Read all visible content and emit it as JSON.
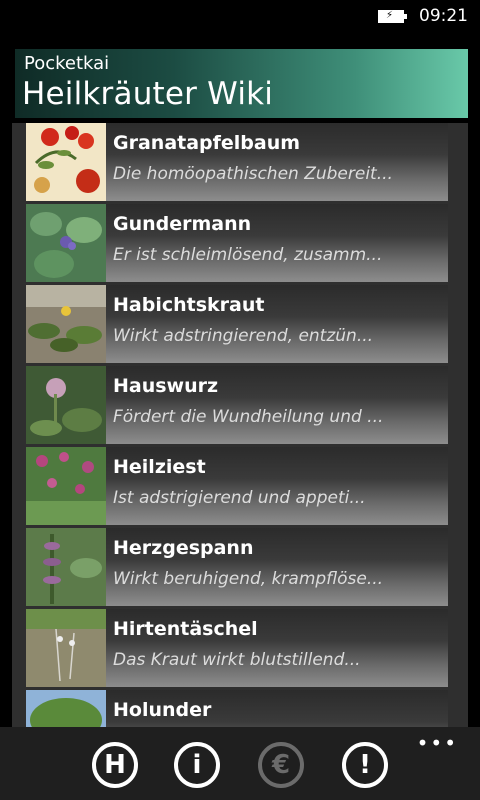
{
  "status": {
    "time": "09:21"
  },
  "header": {
    "app_name": "Pocketkai",
    "title": "Heilkräuter Wiki"
  },
  "list": [
    {
      "title": "Granatapfelbaum",
      "desc": "Die homöopathischen Zubereit..."
    },
    {
      "title": "Gundermann",
      "desc": "Er ist schleimlösend, zusamm..."
    },
    {
      "title": "Habichtskraut",
      "desc": "Wirkt adstringierend, entzün..."
    },
    {
      "title": "Hauswurz",
      "desc": "Fördert die Wundheilung und ..."
    },
    {
      "title": "Heilziest",
      "desc": "Ist adstrigierend und appeti..."
    },
    {
      "title": "Herzgespann",
      "desc": "Wirkt beruhigend, krampflöse..."
    },
    {
      "title": "Hirtentäschel",
      "desc": "Das Kraut wirkt blutstillend..."
    },
    {
      "title": "Holunder",
      "desc": ""
    }
  ],
  "appbar": {
    "buttons": [
      {
        "glyph": "H",
        "icon": "home-icon"
      },
      {
        "glyph": "i",
        "icon": "info-icon"
      },
      {
        "glyph": "€",
        "icon": "euro-icon"
      },
      {
        "glyph": "!",
        "icon": "alert-icon"
      }
    ],
    "more": "•••"
  }
}
